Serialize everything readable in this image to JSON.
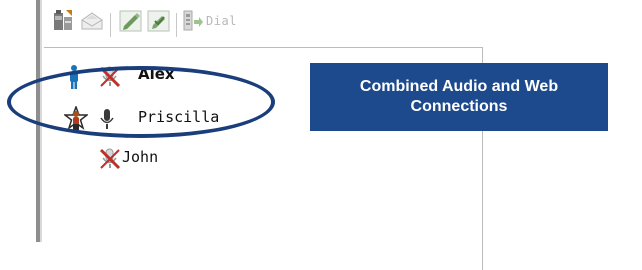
{
  "toolbar": {
    "buttons": [
      {
        "icon": "participant-info-icon"
      },
      {
        "icon": "envelope-icon"
      },
      {
        "icon": "edit-green-icon"
      },
      {
        "icon": "edit-check-icon"
      },
      {
        "icon": "dial-icon"
      }
    ],
    "dial_label": "Dial"
  },
  "participants": [
    {
      "name": "Alex",
      "role_icon": "presenter-person-icon",
      "audio_icon": "muted-microphone-icon",
      "bold": true
    },
    {
      "name": "Priscilla",
      "role_icon": "host-star-person-icon",
      "audio_icon": "microphone-icon",
      "bold": false
    },
    {
      "name": "John",
      "role_icon": "",
      "audio_icon": "muted-microphone-icon",
      "bold": false
    }
  ],
  "callout": {
    "text": "Combined Audio and Web Connections"
  },
  "colors": {
    "callout_bg": "#1d4a8c",
    "ellipse": "#1a3d7c"
  }
}
